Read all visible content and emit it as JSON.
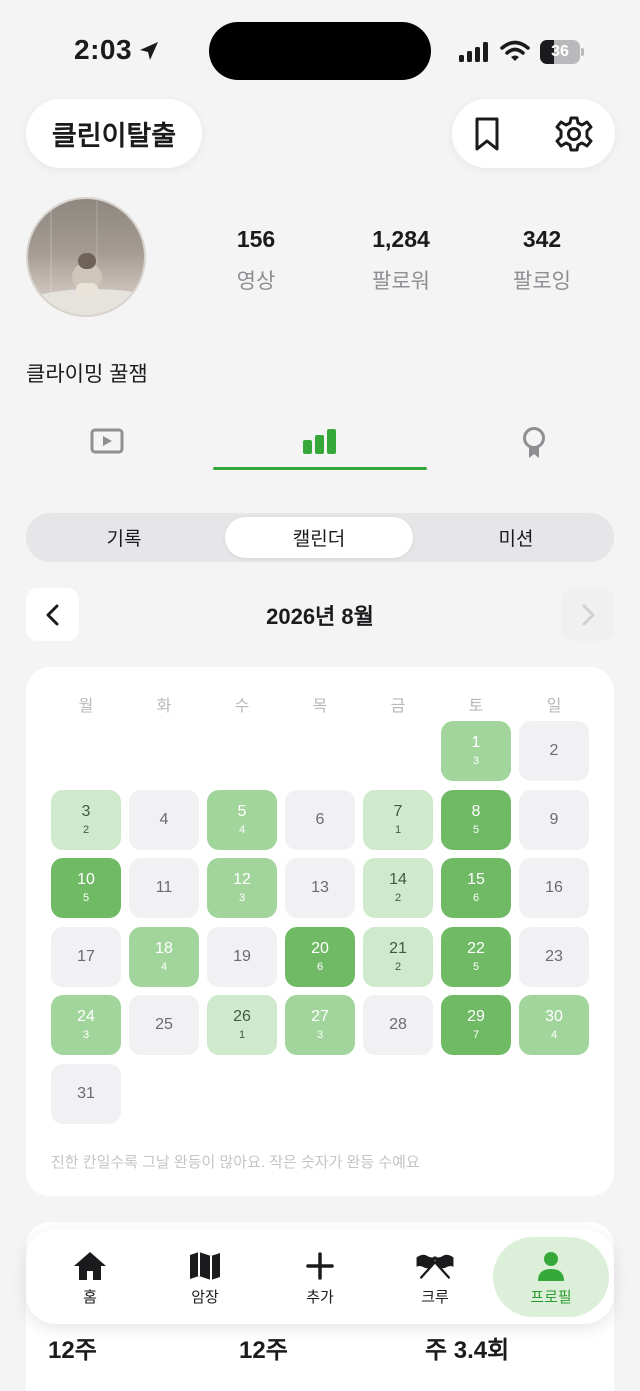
{
  "status_bar": {
    "time": "2:03",
    "battery": "36",
    "battery_level": 0.36
  },
  "header": {
    "title": "클린이탈출",
    "bookmark_icon": "bookmark-icon",
    "settings_icon": "gear-icon"
  },
  "profile": {
    "stats": [
      {
        "value": "156",
        "label": "영상"
      },
      {
        "value": "1,284",
        "label": "팔로워"
      },
      {
        "value": "342",
        "label": "팔로잉"
      }
    ],
    "bio": "클라이밍 꿀잼"
  },
  "profile_tabs": [
    {
      "icon": "video-icon",
      "active": false
    },
    {
      "icon": "bar-chart-icon",
      "active": true
    },
    {
      "icon": "badge-icon",
      "active": false
    }
  ],
  "segments": [
    {
      "label": "기록",
      "active": false
    },
    {
      "label": "캘린더",
      "active": true
    },
    {
      "label": "미션",
      "active": false
    }
  ],
  "calendar": {
    "month_label": "2026년 8월",
    "weekdays": [
      "월",
      "화",
      "수",
      "목",
      "금",
      "토",
      "일"
    ],
    "days": [
      {
        "d": "1",
        "c": "3",
        "lv": 2
      },
      {
        "d": "2",
        "c": "",
        "lv": 0
      },
      {
        "d": "3",
        "c": "2",
        "lv": 1
      },
      {
        "d": "4",
        "c": "",
        "lv": 0
      },
      {
        "d": "5",
        "c": "4",
        "lv": 2
      },
      {
        "d": "6",
        "c": "",
        "lv": 0
      },
      {
        "d": "7",
        "c": "1",
        "lv": 1
      },
      {
        "d": "8",
        "c": "5",
        "lv": 3
      },
      {
        "d": "9",
        "c": "",
        "lv": 0
      },
      {
        "d": "10",
        "c": "5",
        "lv": 3
      },
      {
        "d": "11",
        "c": "",
        "lv": 0
      },
      {
        "d": "12",
        "c": "3",
        "lv": 2
      },
      {
        "d": "13",
        "c": "",
        "lv": 0
      },
      {
        "d": "14",
        "c": "2",
        "lv": 1
      },
      {
        "d": "15",
        "c": "6",
        "lv": 3
      },
      {
        "d": "16",
        "c": "",
        "lv": 0
      },
      {
        "d": "17",
        "c": "",
        "lv": 0
      },
      {
        "d": "18",
        "c": "4",
        "lv": 2
      },
      {
        "d": "19",
        "c": "",
        "lv": 0
      },
      {
        "d": "20",
        "c": "6",
        "lv": 3
      },
      {
        "d": "21",
        "c": "2",
        "lv": 1
      },
      {
        "d": "22",
        "c": "5",
        "lv": 3
      },
      {
        "d": "23",
        "c": "",
        "lv": 0
      },
      {
        "d": "24",
        "c": "3",
        "lv": 2
      },
      {
        "d": "25",
        "c": "",
        "lv": 0
      },
      {
        "d": "26",
        "c": "1",
        "lv": 1
      },
      {
        "d": "27",
        "c": "3",
        "lv": 2
      },
      {
        "d": "28",
        "c": "",
        "lv": 0
      },
      {
        "d": "29",
        "c": "7",
        "lv": 3
      },
      {
        "d": "30",
        "c": "4",
        "lv": 2
      },
      {
        "d": "31",
        "c": "",
        "lv": 0
      }
    ],
    "note": "진한 칸일수록 그날 완등이 많아요. 작은 숫자가 완등 수예요"
  },
  "summary": [
    "12주",
    "12주",
    "주 3.4회"
  ],
  "tab_bar": [
    {
      "label": "홈",
      "icon": "home-icon",
      "active": false
    },
    {
      "label": "암장",
      "icon": "map-icon",
      "active": false
    },
    {
      "label": "추가",
      "icon": "plus-icon",
      "active": false
    },
    {
      "label": "크루",
      "icon": "crossed-flags-icon",
      "active": false
    },
    {
      "label": "프로필",
      "icon": "person-icon",
      "active": true
    }
  ],
  "colors": {
    "accent": "#36a83a",
    "level1": "#cfe9cd",
    "level2": "#a2d59c",
    "level3": "#70ba66",
    "empty": "#f1f1f4"
  }
}
